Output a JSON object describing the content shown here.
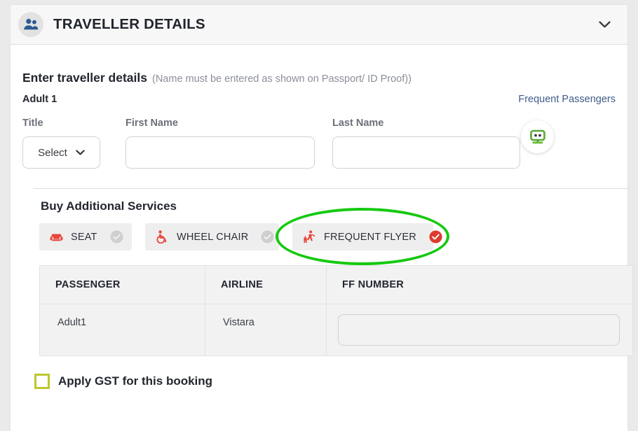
{
  "header": {
    "title": "TRAVELLER DETAILS",
    "icon": "people-icon",
    "collapse_icon": "chevron-down-icon"
  },
  "main": {
    "section_heading": "Enter traveller details",
    "section_note": "(Name must be entered as shown on Passport/ ID Proof))",
    "adult_label": "Adult 1",
    "frequent_passengers_link": "Frequent Passengers",
    "bot_icon": "robot-assistant-icon"
  },
  "fields": {
    "title": {
      "label": "Title",
      "value": "Select",
      "chevron_icon": "chevron-down-icon"
    },
    "first_name": {
      "label": "First Name",
      "value": "",
      "placeholder": ""
    },
    "last_name": {
      "label": "Last Name",
      "value": "",
      "placeholder": ""
    }
  },
  "services": {
    "title": "Buy Additional Services",
    "chips": [
      {
        "label": "SEAT",
        "icon": "seat-icon",
        "selected": false
      },
      {
        "label": "WHEEL CHAIR",
        "icon": "wheelchair-icon",
        "selected": false
      },
      {
        "label": "FREQUENT FLYER",
        "icon": "frequent-flyer-icon",
        "selected": true
      }
    ]
  },
  "ff_table": {
    "columns": [
      "PASSENGER",
      "AIRLINE",
      "FF NUMBER"
    ],
    "rows": [
      {
        "passenger": "Adult1",
        "airline": "Vistara",
        "ff_number": "",
        "ff_placeholder": ""
      }
    ]
  },
  "gst": {
    "label": "Apply GST for this booking",
    "checked": false
  },
  "colors": {
    "accent_red": "#e8453c",
    "link_blue": "#3f5c88",
    "annotation_green": "#16c910",
    "checkbox_olive": "#bdc72e",
    "bot_green": "#5ba83f",
    "chip_bg": "#eeeeee",
    "table_bg": "#f2f2f2"
  }
}
